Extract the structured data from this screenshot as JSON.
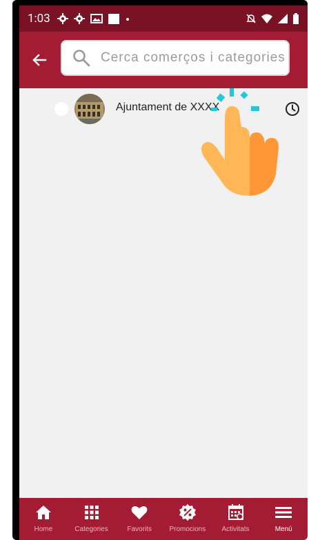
{
  "status_bar": {
    "time": "1:03"
  },
  "search": {
    "placeholder": "Cerca comerços i categories",
    "value": ""
  },
  "results": [
    {
      "title": "Ajuntament de XXXX"
    }
  ],
  "bottom_nav": {
    "items": [
      {
        "label": "Home",
        "icon": "home-icon"
      },
      {
        "label": "Categories",
        "icon": "grid-icon"
      },
      {
        "label": "Favorits",
        "icon": "heart-icon"
      },
      {
        "label": "Promocions",
        "icon": "discount-badge-icon"
      },
      {
        "label": "Activitats",
        "icon": "calendar-icon"
      },
      {
        "label": "Menú",
        "icon": "menu-icon"
      }
    ],
    "active": "Menú"
  },
  "colors": {
    "status_bar": "#781224",
    "app_bar": "#a31c33",
    "background": "#f1f1f1",
    "hand_light": "#ffb657",
    "hand_dark": "#ff9736",
    "tap_marks": "#26c6da"
  }
}
